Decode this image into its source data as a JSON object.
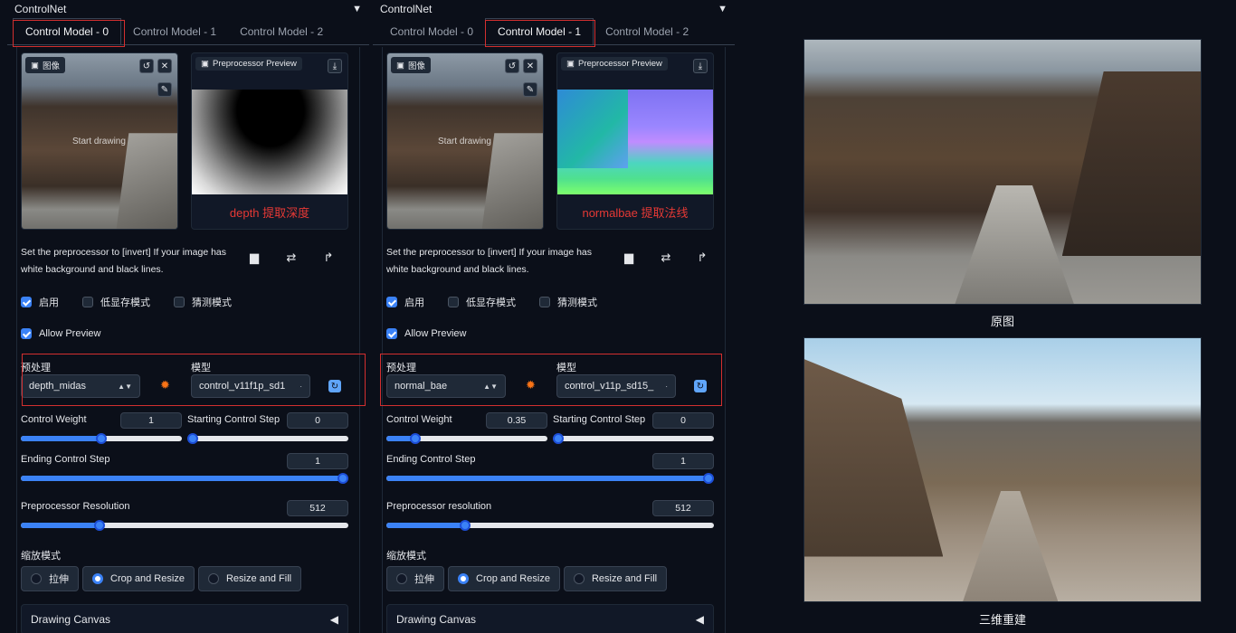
{
  "panels": [
    {
      "header": "ControlNet",
      "tabs": [
        "Control Model - 0",
        "Control Model - 1",
        "Control Model - 2"
      ],
      "active_tab": 0,
      "image_label": "图像",
      "start_drawing": "Start drawing",
      "preview_label": "Preprocessor Preview",
      "preview_caption": "depth 提取深度",
      "help_text": "Set the preprocessor to [invert] If your image has white background and black lines.",
      "checks": {
        "enable": "启用",
        "low_vram": "低显存模式",
        "guess": "猜测模式",
        "allow_preview": "Allow Preview"
      },
      "preprocessor_label": "预处理",
      "preprocessor_value": "depth_midas",
      "model_label": "模型",
      "model_value": "control_v11f1p_sd1",
      "control_weight_label": "Control Weight",
      "control_weight": "1",
      "control_weight_frac": 0.5,
      "start_step_label": "Starting Control Step",
      "start_step": "0",
      "start_step_frac": 0.0,
      "end_step_label": "Ending Control Step",
      "end_step": "1",
      "end_step_frac": 1.0,
      "res_label": "Preprocessor Resolution",
      "res_value": "512",
      "res_frac": 0.24,
      "resize_label": "缩放模式",
      "resize_options": [
        "拉伸",
        "Crop and Resize",
        "Resize and Fill"
      ],
      "resize_selected": 1,
      "drawing_canvas": "Drawing Canvas"
    },
    {
      "header": "ControlNet",
      "tabs": [
        "Control Model - 0",
        "Control Model - 1",
        "Control Model - 2"
      ],
      "active_tab": 1,
      "image_label": "图像",
      "start_drawing": "Start drawing",
      "preview_label": "Preprocessor Preview",
      "preview_caption": "normalbae 提取法线",
      "help_text": "Set the preprocessor to [invert] If your image has white background and black lines.",
      "checks": {
        "enable": "启用",
        "low_vram": "低显存模式",
        "guess": "猜测模式",
        "allow_preview": "Allow Preview"
      },
      "preprocessor_label": "预处理",
      "preprocessor_value": "normal_bae",
      "model_label": "模型",
      "model_value": "control_v11p_sd15_",
      "control_weight_label": "Control Weight",
      "control_weight": "0.35",
      "control_weight_frac": 0.18,
      "start_step_label": "Starting Control Step",
      "start_step": "0",
      "start_step_frac": 0.0,
      "end_step_label": "Ending Control Step",
      "end_step": "1",
      "end_step_frac": 1.0,
      "res_label": "Preprocessor resolution",
      "res_value": "512",
      "res_frac": 0.24,
      "resize_label": "缩放模式",
      "resize_options": [
        "拉伸",
        "Crop and Resize",
        "Resize and Fill"
      ],
      "resize_selected": 1,
      "drawing_canvas": "Drawing Canvas"
    }
  ],
  "right": {
    "original_caption": "原图",
    "render_caption": "三维重建"
  },
  "colors": {
    "accent": "#3b82f6",
    "highlight": "#d32f2f",
    "caption_red": "#e53935"
  }
}
